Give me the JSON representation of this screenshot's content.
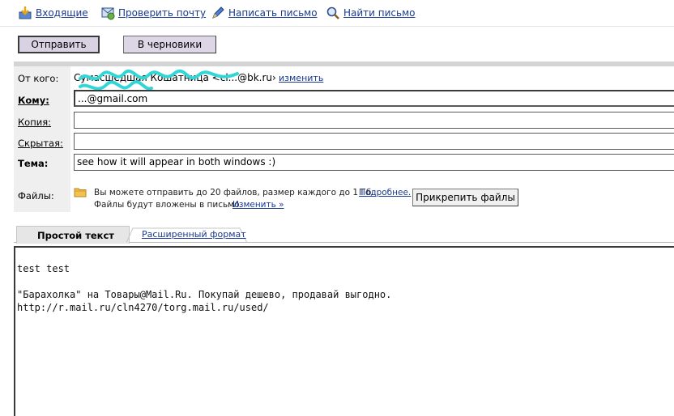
{
  "nav": {
    "inbox": "Входящие",
    "check": "Проверить почту",
    "compose": "Написать письмо",
    "find": "Найти письмо"
  },
  "actions": {
    "send": "Отправить",
    "draft": "В черновики"
  },
  "form": {
    "from_label": "От кого:",
    "from_value": "Сумасшедшая Кошатница <cl...@bk.ru›",
    "from_change": "изменить",
    "to_label": "Кому:",
    "to_value": "...@gmail.com",
    "cc_label": "Копия:",
    "cc_value": "",
    "bcc_label": "Скрытая:",
    "bcc_value": "",
    "subject_label": "Тема:",
    "subject_value": "see how it will appear in both windows :)",
    "files_label": "Файлы:",
    "files_line1": "Вы можете отправить до 20 файлов, размер каждого до 1 Гб.",
    "files_more": "Подробнее.",
    "files_line2": "Файлы будут вложены в письмо.",
    "files_change": "Изменить »",
    "attach_button": "Прикрепить файлы"
  },
  "tabs": {
    "plain": "Простой текст",
    "rich": "Расширенный формат"
  },
  "body": {
    "text": "test test\n\n\"Барахолка\" на Товары@Mail.Ru. Покупай дешево, продавай выгодно.\nhttp://r.mail.ru/cln4270/torg.mail.ru/used/"
  },
  "colors": {
    "link": "#1a3a8f",
    "scribble": "#33d6d6"
  },
  "icons": {
    "inbox": "inbox-arrow-icon",
    "check": "refresh-mail-icon",
    "compose": "pen-icon",
    "find": "magnifier-icon",
    "files": "folder-icon"
  }
}
